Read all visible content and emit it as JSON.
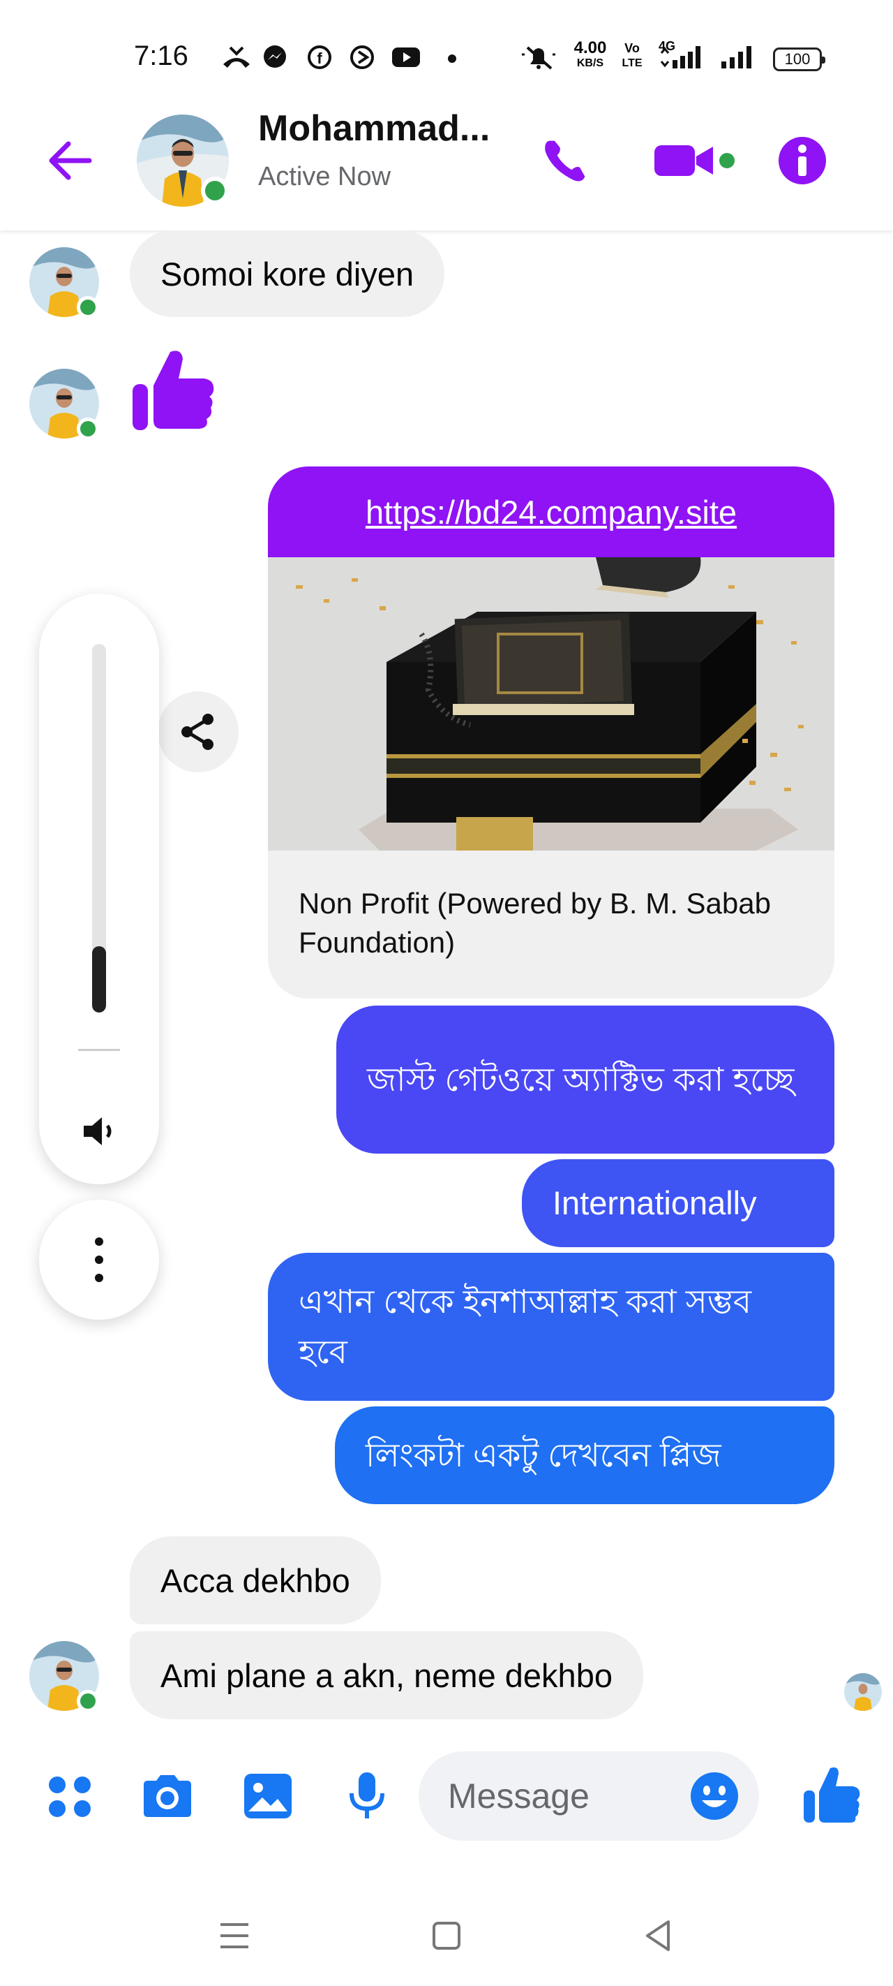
{
  "status_bar": {
    "time": "7:16",
    "net_speed": "4.00",
    "net_unit": "KB/S",
    "volte_top": "Vo",
    "volte_bottom": "LTE",
    "network": "4G",
    "battery": "100"
  },
  "header": {
    "contact_name": "Mohammad...",
    "status": "Active Now"
  },
  "messages": {
    "m1": "Somoi kore diyen",
    "link_url": "https://bd24.company.site",
    "link_caption": "Non Profit (Powered by B. M. Sabab Foundation)",
    "out1": "জাস্ট গেটওয়ে অ্যাক্টিভ করা হচ্ছে",
    "out2": "Internationally",
    "out3": "এখান থেকে ইনশাআল্লাহ করা সম্ভব হবে",
    "out4": "লিংকটা একটু দেখবেন প্লিজ",
    "in2": "Acca dekhbo",
    "in3": "Ami plane a akn, neme dekhbo"
  },
  "volume_level": 0.18,
  "composer": {
    "placeholder": "Message"
  },
  "colors": {
    "accent": "#8f13f5",
    "online": "#31a24c",
    "out_bubble_top": "#5b3ef2",
    "out_bubble_bottom": "#1877f2",
    "composer_icons": "#1877f2"
  }
}
